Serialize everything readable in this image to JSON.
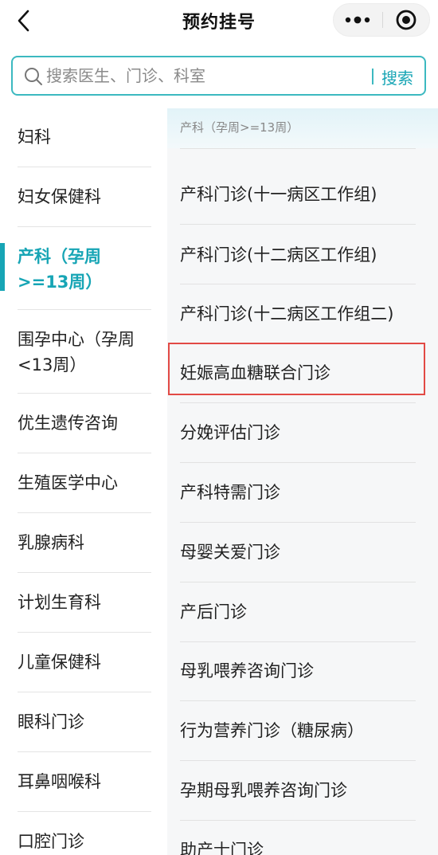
{
  "header": {
    "title": "预约挂号",
    "back_icon": "chevron-left-icon",
    "more_icon": "more-dots-icon",
    "close_icon": "target-circle-icon"
  },
  "search": {
    "placeholder": "搜索医生、门诊、科室",
    "button_label": "搜索",
    "accent_color": "#17a5b5"
  },
  "sidebar": {
    "active_index": 2,
    "items": [
      {
        "label": "妇科"
      },
      {
        "label": "妇女保健科"
      },
      {
        "label": "产科（孕周>=13周）"
      },
      {
        "label": "围孕中心（孕周<13周）"
      },
      {
        "label": "优生遗传咨询"
      },
      {
        "label": "生殖医学中心"
      },
      {
        "label": "乳腺病科"
      },
      {
        "label": "计划生育科"
      },
      {
        "label": "儿童保健科"
      },
      {
        "label": "眼科门诊"
      },
      {
        "label": "耳鼻咽喉科"
      },
      {
        "label": "口腔门诊"
      }
    ]
  },
  "clinic_list": {
    "section_title": "产科（孕周>=13周）",
    "highlighted_index": 3,
    "highlight_color": "#e24a45",
    "items": [
      {
        "label": "产科门诊(十一病区工作组)"
      },
      {
        "label": "产科门诊(十二病区工作组)"
      },
      {
        "label": "产科门诊(十二病区工作组二)"
      },
      {
        "label": "妊娠高血糖联合门诊"
      },
      {
        "label": "分娩评估门诊"
      },
      {
        "label": "产科特需门诊"
      },
      {
        "label": "母婴关爱门诊"
      },
      {
        "label": "产后门诊"
      },
      {
        "label": "母乳喂养咨询门诊"
      },
      {
        "label": "行为营养门诊（糖尿病）"
      },
      {
        "label": "孕期母乳喂养咨询门诊"
      },
      {
        "label": "助产士门诊"
      }
    ]
  }
}
